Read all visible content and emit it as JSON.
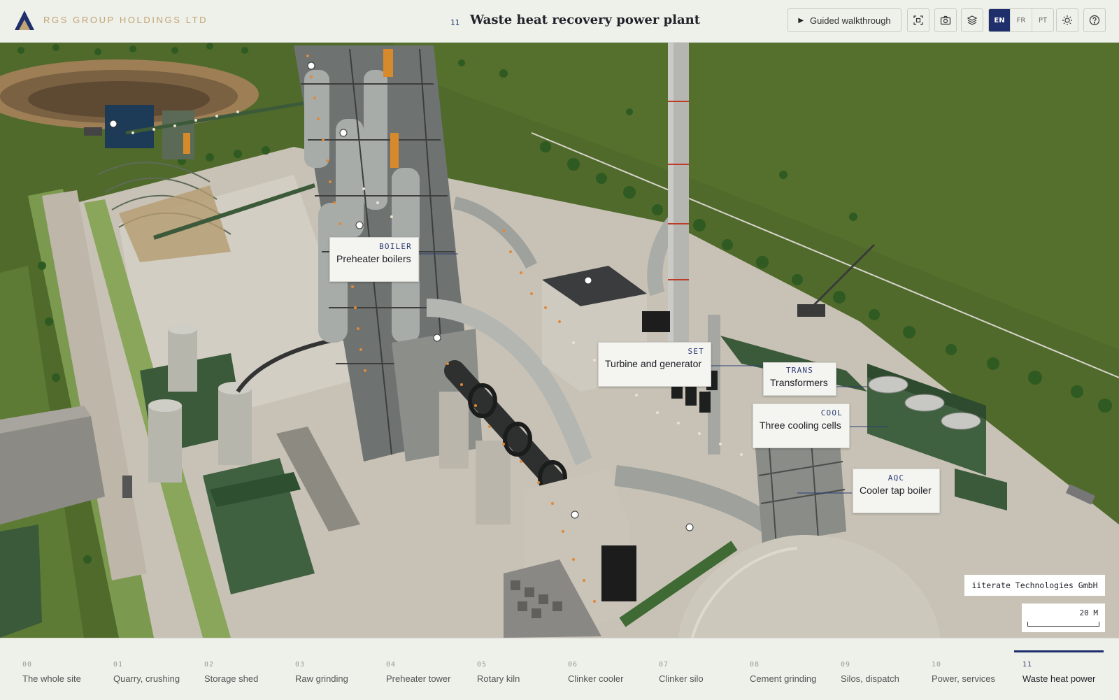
{
  "header": {
    "brand": "RGS GROUP HOLDINGS LTD",
    "section_number": "11",
    "title": "Waste heat recovery power plant",
    "guided_label": "Guided walkthrough",
    "languages": [
      {
        "code": "EN",
        "active": true
      },
      {
        "code": "FR",
        "active": false
      },
      {
        "code": "PT",
        "active": false
      }
    ],
    "icons": [
      "play-icon",
      "focus-frame-icon",
      "camera-icon",
      "layers-icon",
      "sun-icon",
      "help-icon"
    ]
  },
  "callouts": [
    {
      "code": "BOILER",
      "label": "Preheater boilers"
    },
    {
      "code": "SET",
      "label": "Turbine and generator"
    },
    {
      "code": "TRANS",
      "label": "Transformers"
    },
    {
      "code": "COOL",
      "label": "Three cooling cells"
    },
    {
      "code": "AQC",
      "label": "Cooler tap boiler"
    }
  ],
  "credit": "iiterate Technologies GmbH",
  "scale_label": "20 M",
  "nav": [
    {
      "num": "00",
      "name": "The whole site"
    },
    {
      "num": "01",
      "name": "Quarry, crushing"
    },
    {
      "num": "02",
      "name": "Storage shed"
    },
    {
      "num": "03",
      "name": "Raw grinding"
    },
    {
      "num": "04",
      "name": "Preheater tower"
    },
    {
      "num": "05",
      "name": "Rotary kiln"
    },
    {
      "num": "06",
      "name": "Clinker cooler"
    },
    {
      "num": "07",
      "name": "Clinker silo"
    },
    {
      "num": "08",
      "name": "Cement grinding"
    },
    {
      "num": "09",
      "name": "Silos, dispatch"
    },
    {
      "num": "10",
      "name": "Power, services"
    },
    {
      "num": "11",
      "name": "Waste heat power",
      "active": true
    }
  ],
  "colors": {
    "accent": "#1f2f6b",
    "brand": "#c2a574",
    "grass": "#4f6a2a",
    "concrete": "#c7c1b5",
    "roof_green": "#3b5a3a"
  }
}
